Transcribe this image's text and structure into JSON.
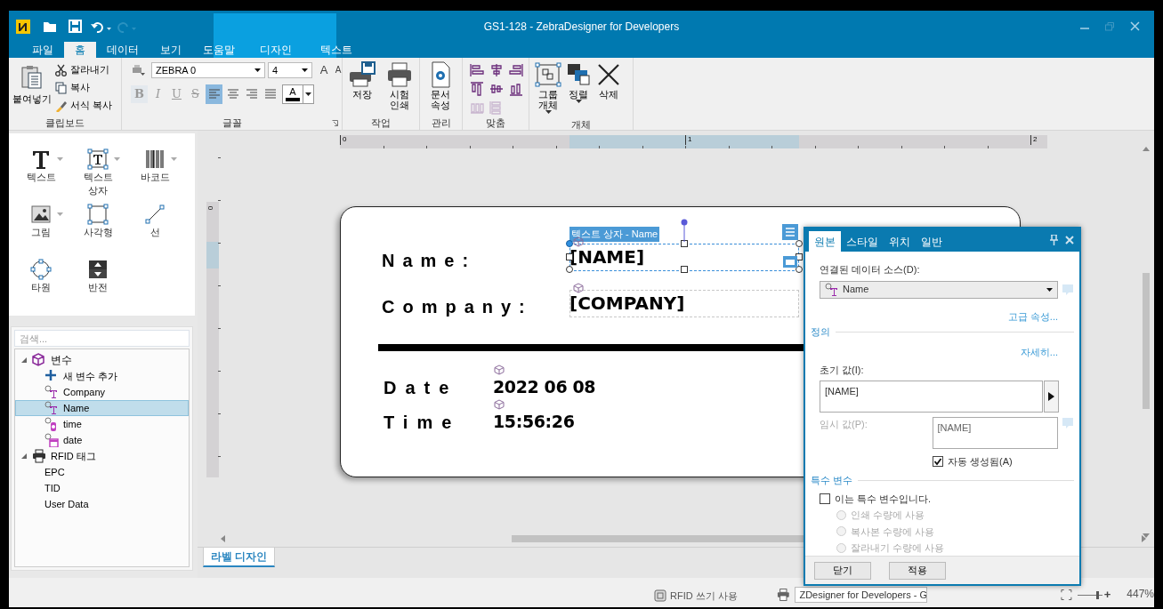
{
  "window": {
    "title": "GS1-128 - ZebraDesigner for Developers"
  },
  "ribbon_tabs": [
    {
      "label": "파일",
      "selected": false,
      "kind": "normal"
    },
    {
      "label": "홈",
      "selected": true,
      "kind": "normal"
    },
    {
      "label": "데이터",
      "selected": false,
      "kind": "normal"
    },
    {
      "label": "보기",
      "selected": false,
      "kind": "normal"
    },
    {
      "label": "도움말",
      "selected": false,
      "kind": "normal"
    },
    {
      "label": "디자인",
      "selected": false,
      "kind": "context"
    },
    {
      "label": "텍스트",
      "selected": false,
      "kind": "context"
    }
  ],
  "clipboard_group": {
    "label": "클립보드",
    "paste": "붙여넣기",
    "commands": [
      {
        "label": "잘라내기",
        "kind": "cut"
      },
      {
        "label": "복사",
        "kind": "copy"
      },
      {
        "label": "서식 복사",
        "kind": "format"
      }
    ]
  },
  "font_group": {
    "label": "글꼴",
    "font": "ZEBRA 0",
    "size": "4",
    "grow": "A",
    "shrink": "A",
    "style_buttons": [
      {
        "label": "B",
        "kind": "bold",
        "disabled": true
      },
      {
        "label": "I",
        "kind": "italic",
        "disabled": true
      },
      {
        "label": "U",
        "kind": "underline",
        "disabled": true
      },
      {
        "label": "S",
        "kind": "strike",
        "disabled": true
      }
    ],
    "align_buttons": [
      {
        "selected": true
      },
      {
        "selected": false
      },
      {
        "selected": false
      },
      {
        "selected": false
      }
    ],
    "color_button": "A"
  },
  "action_group": {
    "label": "작업",
    "buttons": [
      {
        "label": "저장",
        "kind": "save"
      },
      {
        "label": "시험\n인쇄",
        "kind": "print"
      }
    ]
  },
  "manage_group": {
    "label": "관리",
    "buttons": [
      {
        "label": "문서\n속성",
        "kind": "doc"
      }
    ]
  },
  "align_group": {
    "label": "맞춤",
    "tools": [
      {
        "disabled": false
      },
      {
        "disabled": false
      },
      {
        "disabled": false
      },
      {
        "disabled": false
      },
      {
        "disabled": false
      },
      {
        "disabled": false
      },
      {
        "disabled": true
      },
      {
        "disabled": true
      }
    ]
  },
  "object_group": {
    "label": "개체",
    "buttons": [
      {
        "label": "그룹\n개체",
        "kind": "group",
        "dropdown": true
      },
      {
        "label": "정렬",
        "kind": "arrange",
        "dropdown": true
      },
      {
        "label": "삭제",
        "kind": "delete",
        "dropdown": false
      }
    ]
  },
  "toolbox": [
    {
      "label": "텍스트",
      "kind": "text",
      "dropdown": true
    },
    {
      "label": "텍스트\n상자",
      "kind": "textbox",
      "dropdown": true
    },
    {
      "label": "바코드",
      "kind": "barcode",
      "dropdown": true
    },
    {
      "label": "그림",
      "kind": "image",
      "dropdown": true
    },
    {
      "label": "사각형",
      "kind": "rect",
      "dropdown": false
    },
    {
      "label": "선",
      "kind": "line",
      "dropdown": false
    },
    {
      "label": "타원",
      "kind": "ellipse",
      "dropdown": false
    },
    {
      "label": "반전",
      "kind": "invert",
      "dropdown": false
    }
  ],
  "search": {
    "placeholder": "검색..."
  },
  "tree": [
    {
      "label": "변수",
      "kind": "folder",
      "expanded": true,
      "selected": false,
      "children": [
        {
          "label": "새 변수 추가",
          "kind": "add",
          "selected": false
        },
        {
          "label": "Company",
          "kind": "text",
          "selected": false
        },
        {
          "label": "Name",
          "kind": "text",
          "selected": true
        },
        {
          "label": "time",
          "kind": "time",
          "selected": false
        },
        {
          "label": "date",
          "kind": "date",
          "selected": false
        }
      ]
    },
    {
      "label": "RFID 태그",
      "kind": "rfid",
      "expanded": true,
      "selected": false,
      "children": [
        {
          "label": "EPC",
          "kind": "plain",
          "selected": false
        },
        {
          "label": "TID",
          "kind": "plain",
          "selected": false
        },
        {
          "label": "User Data",
          "kind": "plain",
          "selected": false
        }
      ]
    }
  ],
  "ruler": {
    "marks": [
      "0",
      "1",
      "2"
    ],
    "vertical_mark": "0"
  },
  "label": {
    "selection_caption": "텍스트 상자 - Name",
    "fields": [
      {
        "label": "Name:",
        "value": "[NAME]",
        "selected": true
      },
      {
        "label": "Company:",
        "value": "[COMPANY]",
        "selected": false
      }
    ],
    "rows": [
      {
        "label": "Date",
        "value": "2022 06 08"
      },
      {
        "label": "Time",
        "value": "15:56:26"
      }
    ]
  },
  "design_tabs": [
    {
      "label": "라벨 디자인",
      "selected": true
    }
  ],
  "properties_dialog": {
    "tabs": [
      {
        "label": "원본",
        "selected": true
      },
      {
        "label": "스타일",
        "selected": false
      },
      {
        "label": "위치",
        "selected": false
      },
      {
        "label": "일반",
        "selected": false
      }
    ],
    "data_source_label": "연결된 데이터 소스(D):",
    "data_source": "Name",
    "advanced_link": "고급 속성...",
    "definition_section": "정의",
    "details_link": "자세히...",
    "initial_label": "초기 값(I):",
    "initial_value": "[NAME]",
    "temp_label": "임시 값(P):",
    "temp_value": "[NAME]",
    "temp_disabled": true,
    "auto_generated": {
      "label": "자동 생성됨(A)",
      "checked": true
    },
    "special_section": "특수 변수",
    "special_checkbox": {
      "label": "이는 특수 변수입니다.",
      "checked": false
    },
    "radios": [
      {
        "label": "인쇄 수량에 사용",
        "selected": false,
        "disabled": true
      },
      {
        "label": "복사본 수량에 사용",
        "selected": false,
        "disabled": true
      },
      {
        "label": "잘라내기 수량에 사용",
        "selected": false,
        "disabled": true
      }
    ],
    "buttons": [
      "닫기",
      "적용"
    ]
  },
  "status_bar": {
    "rfid": "RFID 쓰기 사용",
    "printer": "ZDesigner for Developers - G",
    "zoom": "447%",
    "zoom_in": "+",
    "zoom_slider": {
      "level": 0.75
    }
  }
}
